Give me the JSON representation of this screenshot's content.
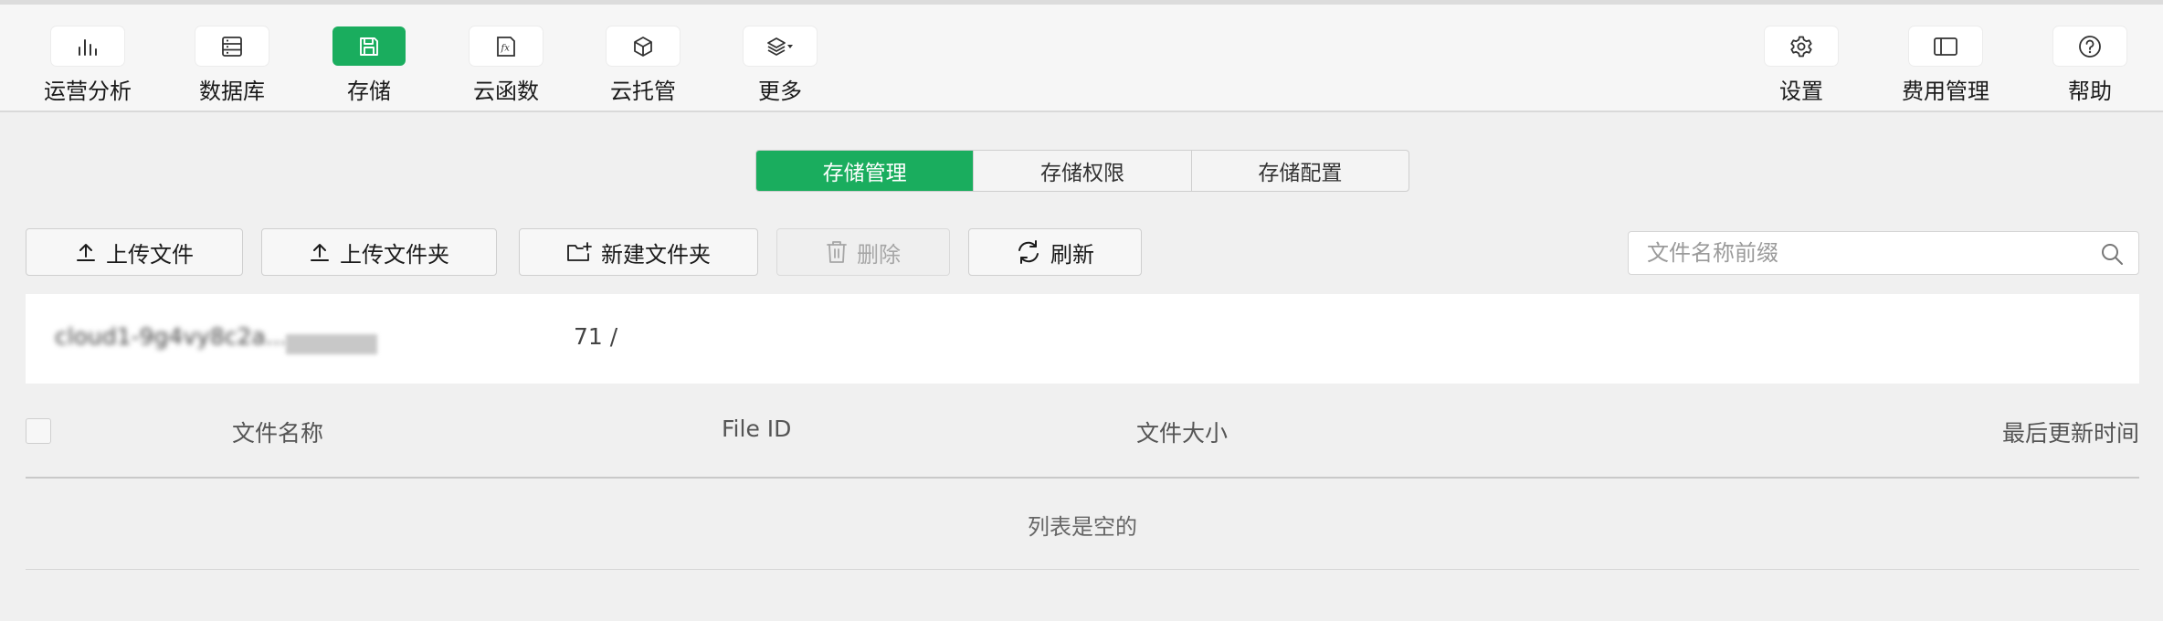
{
  "nav": {
    "items": [
      {
        "label": "运营分析",
        "icon": "bar-chart-icon",
        "active": false
      },
      {
        "label": "数据库",
        "icon": "database-icon",
        "active": false
      },
      {
        "label": "存储",
        "icon": "save-disk-icon",
        "active": true
      },
      {
        "label": "云函数",
        "icon": "fx-function-icon",
        "active": false
      },
      {
        "label": "云托管",
        "icon": "cube-icon",
        "active": false
      },
      {
        "label": "更多",
        "icon": "layers-icon",
        "active": false
      }
    ],
    "right_items": [
      {
        "label": "设置",
        "icon": "gear-icon"
      },
      {
        "label": "费用管理",
        "icon": "billing-icon"
      },
      {
        "label": "帮助",
        "icon": "help-icon"
      }
    ]
  },
  "tabs": [
    {
      "label": "存储管理",
      "active": true
    },
    {
      "label": "存储权限",
      "active": false
    },
    {
      "label": "存储配置",
      "active": false
    }
  ],
  "actions": {
    "upload_file": "上传文件",
    "upload_folder": "上传文件夹",
    "new_folder": "新建文件夹",
    "delete": "删除",
    "refresh": "刷新"
  },
  "search": {
    "placeholder": "文件名称前缀",
    "value": ""
  },
  "path": {
    "text": "cloud1-9g4vy8c2a...",
    "separator": "71 /"
  },
  "table": {
    "columns": [
      "文件名称",
      "File ID",
      "文件大小",
      "最后更新时间"
    ],
    "empty_text": "列表是空的"
  },
  "colors": {
    "accent": "#1aad5e",
    "background": "#f0f0f0"
  }
}
